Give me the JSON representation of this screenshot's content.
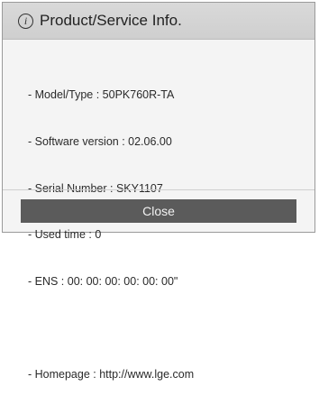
{
  "dialog": {
    "title": "Product/Service Info.",
    "icon": "info-icon",
    "info_icon_glyph": "i",
    "lines": [
      "- Model/Type : 50PK760R-TA",
      "- Software version : 02.06.00",
      "- Serial Number : SKY1107",
      "- Used time : 0",
      "- ENS : 00: 00: 00: 00: 00: 00\""
    ],
    "homepage": "- Homepage : http://www.lge.com",
    "close_label": "Close"
  }
}
